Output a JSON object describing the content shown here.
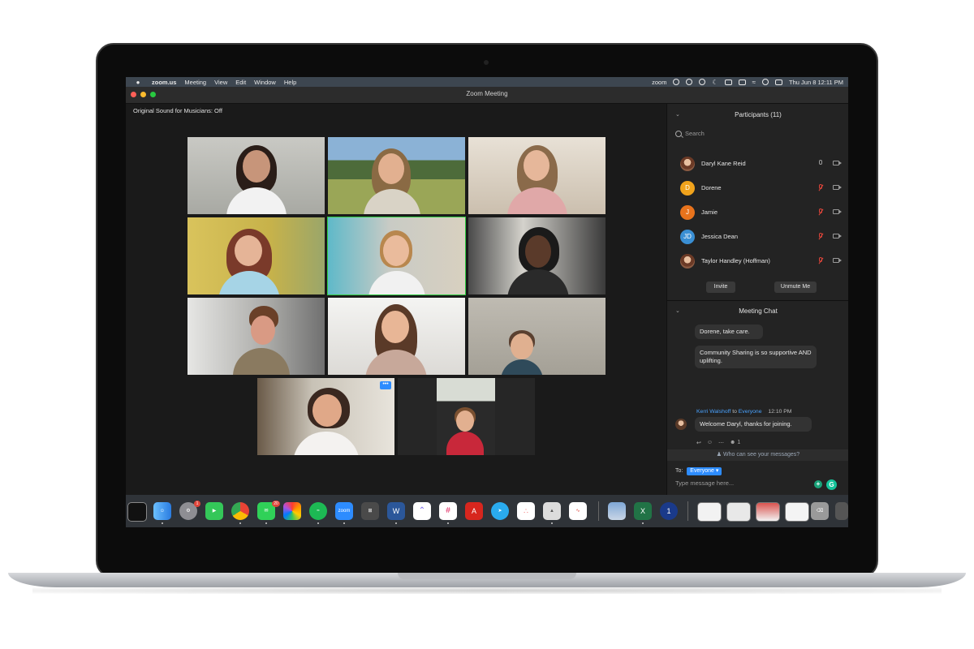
{
  "menubar": {
    "apple": "",
    "items": [
      "zoom.us",
      "Meeting",
      "View",
      "Edit",
      "Window",
      "Help"
    ],
    "status_app": "zoom",
    "datetime": "Thu Jun 8  12:11 PM"
  },
  "window": {
    "title": "Zoom Meeting",
    "sound_label": "Original Sound for Musicians: Off"
  },
  "participants_panel": {
    "title": "Participants (11)",
    "search_placeholder": "Search",
    "participants": [
      {
        "name": "Daryl Kane Reid",
        "initial": "",
        "color": "#8a5a42",
        "muted": false
      },
      {
        "name": "Dorene",
        "initial": "D",
        "color": "#f0a31c",
        "muted": true
      },
      {
        "name": "Jamie",
        "initial": "J",
        "color": "#e8731c",
        "muted": true
      },
      {
        "name": "Jessica Dean",
        "initial": "JD",
        "color": "#3a8fd4",
        "muted": true
      },
      {
        "name": "Taylor Handley (Hoffman)",
        "initial": "",
        "color": "#8a5a42",
        "muted": true
      }
    ],
    "invite_label": "Invite",
    "unmute_label": "Unmute Me"
  },
  "chat": {
    "title": "Meeting Chat",
    "messages": [
      "Dorene, take care.",
      "Community Sharing is so supportive AND uplifting."
    ],
    "last_sender": "Kerri Walshoff",
    "to_word": "to",
    "last_recipient": "Everyone",
    "last_time": "12:10 PM",
    "last_message": "Welcome Daryl, thanks for joining.",
    "reaction_count": "1",
    "who_can_see": "Who can see your messages?",
    "to_label": "To:",
    "to_value": "Everyone",
    "input_placeholder": "Type message here..."
  },
  "dock": {
    "badges": [
      "1",
      "20"
    ],
    "zoom_label": "zoom"
  },
  "colors": {
    "accent": "#2d8cff",
    "active_speaker": "#2ecc40",
    "muted": "#e0453a"
  }
}
